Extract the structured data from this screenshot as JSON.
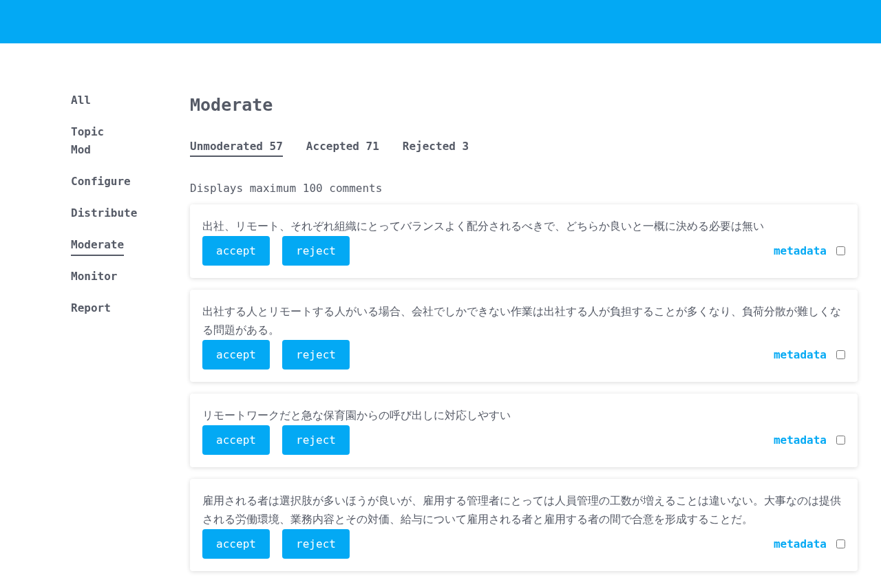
{
  "sidebar": {
    "items": [
      {
        "label": "All",
        "selected": false
      },
      {
        "label": "Topic Mod",
        "selected": false
      },
      {
        "label": "Configure",
        "selected": false
      },
      {
        "label": "Distribute",
        "selected": false
      },
      {
        "label": "Moderate",
        "selected": true
      },
      {
        "label": "Monitor",
        "selected": false
      },
      {
        "label": "Report",
        "selected": false
      }
    ]
  },
  "title": "Moderate",
  "tabs": [
    {
      "label": "Unmoderated 57",
      "selected": true
    },
    {
      "label": "Accepted 71",
      "selected": false
    },
    {
      "label": "Rejected 3",
      "selected": false
    }
  ],
  "note": "Displays maximum 100 comments",
  "comments": [
    {
      "text": "出社、リモート、それぞれ組織にとってバランスよく配分されるべきで、どちらか良いと一概に決める必要は無い",
      "accept": "accept",
      "reject": "reject",
      "metadata": "metadata",
      "checked": false
    },
    {
      "text": "出社する人とリモートする人がいる場合、会社でしかできない作業は出社する人が負担することが多くなり、負荷分散が難しくなる問題がある。",
      "accept": "accept",
      "reject": "reject",
      "metadata": "metadata",
      "checked": false
    },
    {
      "text": "リモートワークだと急な保育園からの呼び出しに対応しやすい",
      "accept": "accept",
      "reject": "reject",
      "metadata": "metadata",
      "checked": false
    },
    {
      "text": "雇用される者は選択肢が多いほうが良いが、雇用する管理者にとっては人員管理の工数が増えることは違いない。大事なのは提供される労働環境、業務内容とその対価、給与について雇用される者と雇用する者の間で合意を形成することだ。",
      "accept": "accept",
      "reject": "reject",
      "metadata": "metadata",
      "checked": false
    }
  ]
}
